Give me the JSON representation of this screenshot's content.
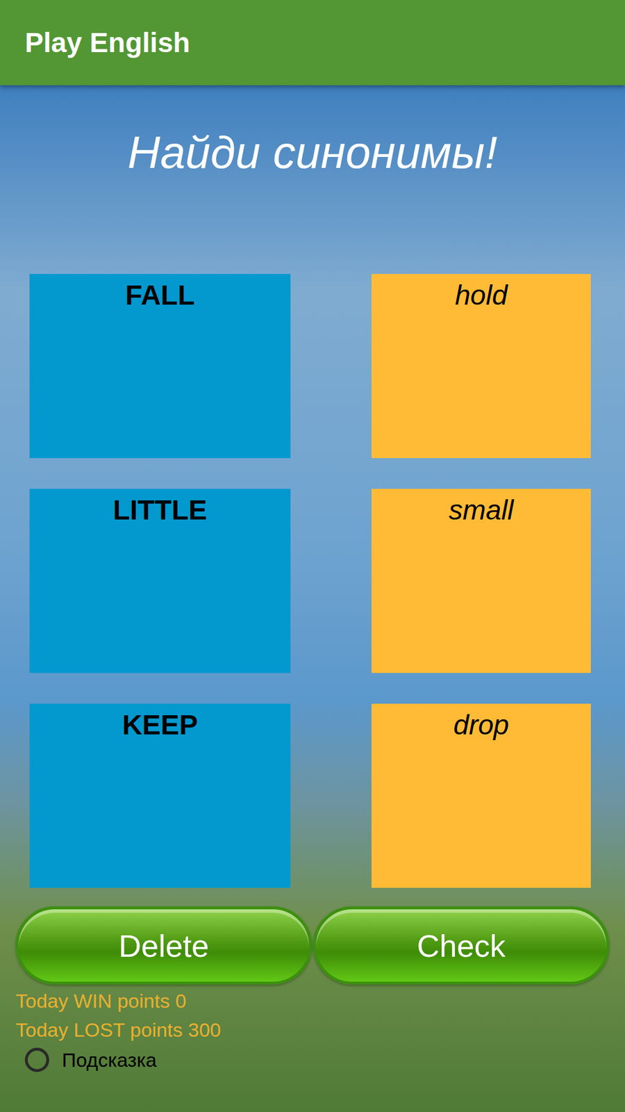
{
  "app_bar": {
    "title": "Play English"
  },
  "heading": "Найди синонимы!",
  "pairs": [
    {
      "word": "FALL",
      "option": "hold"
    },
    {
      "word": "LITTLE",
      "option": "small"
    },
    {
      "word": "KEEP",
      "option": "drop"
    }
  ],
  "buttons": [
    "Delete",
    "Check"
  ],
  "stats": [
    "Today WIN points 0",
    "Today LOST points 300"
  ],
  "hint": {
    "label": "Подсказка",
    "checked": false
  }
}
